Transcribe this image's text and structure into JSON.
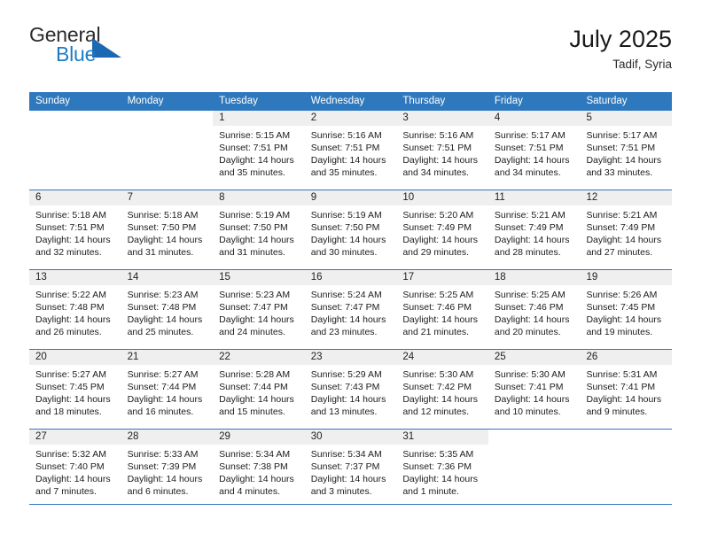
{
  "brand": {
    "name_top": "General",
    "name_bottom": "Blue",
    "triangle_color": "#1b68b3",
    "blue_color": "#1f7bc1"
  },
  "header": {
    "title": "July 2025",
    "subtitle": "Tadif, Syria"
  },
  "theme": {
    "header_blue": "#2e78bd",
    "date_strip_gray": "#efefef",
    "text": "#1c1c1c"
  },
  "weekdays": [
    "Sunday",
    "Monday",
    "Tuesday",
    "Wednesday",
    "Thursday",
    "Friday",
    "Saturday"
  ],
  "labels": {
    "sunrise_prefix": "Sunrise:",
    "sunset_prefix": "Sunset:",
    "daylight_prefix": "Daylight:"
  },
  "weeks": [
    [
      {
        "day": "",
        "line1": "",
        "line2": "",
        "line3": "",
        "line4": ""
      },
      {
        "day": "",
        "line1": "",
        "line2": "",
        "line3": "",
        "line4": ""
      },
      {
        "day": "1",
        "line1": "Sunrise: 5:15 AM",
        "line2": "Sunset: 7:51 PM",
        "line3": "Daylight: 14 hours",
        "line4": "and 35 minutes."
      },
      {
        "day": "2",
        "line1": "Sunrise: 5:16 AM",
        "line2": "Sunset: 7:51 PM",
        "line3": "Daylight: 14 hours",
        "line4": "and 35 minutes."
      },
      {
        "day": "3",
        "line1": "Sunrise: 5:16 AM",
        "line2": "Sunset: 7:51 PM",
        "line3": "Daylight: 14 hours",
        "line4": "and 34 minutes."
      },
      {
        "day": "4",
        "line1": "Sunrise: 5:17 AM",
        "line2": "Sunset: 7:51 PM",
        "line3": "Daylight: 14 hours",
        "line4": "and 34 minutes."
      },
      {
        "day": "5",
        "line1": "Sunrise: 5:17 AM",
        "line2": "Sunset: 7:51 PM",
        "line3": "Daylight: 14 hours",
        "line4": "and 33 minutes."
      }
    ],
    [
      {
        "day": "6",
        "line1": "Sunrise: 5:18 AM",
        "line2": "Sunset: 7:51 PM",
        "line3": "Daylight: 14 hours",
        "line4": "and 32 minutes."
      },
      {
        "day": "7",
        "line1": "Sunrise: 5:18 AM",
        "line2": "Sunset: 7:50 PM",
        "line3": "Daylight: 14 hours",
        "line4": "and 31 minutes."
      },
      {
        "day": "8",
        "line1": "Sunrise: 5:19 AM",
        "line2": "Sunset: 7:50 PM",
        "line3": "Daylight: 14 hours",
        "line4": "and 31 minutes."
      },
      {
        "day": "9",
        "line1": "Sunrise: 5:19 AM",
        "line2": "Sunset: 7:50 PM",
        "line3": "Daylight: 14 hours",
        "line4": "and 30 minutes."
      },
      {
        "day": "10",
        "line1": "Sunrise: 5:20 AM",
        "line2": "Sunset: 7:49 PM",
        "line3": "Daylight: 14 hours",
        "line4": "and 29 minutes."
      },
      {
        "day": "11",
        "line1": "Sunrise: 5:21 AM",
        "line2": "Sunset: 7:49 PM",
        "line3": "Daylight: 14 hours",
        "line4": "and 28 minutes."
      },
      {
        "day": "12",
        "line1": "Sunrise: 5:21 AM",
        "line2": "Sunset: 7:49 PM",
        "line3": "Daylight: 14 hours",
        "line4": "and 27 minutes."
      }
    ],
    [
      {
        "day": "13",
        "line1": "Sunrise: 5:22 AM",
        "line2": "Sunset: 7:48 PM",
        "line3": "Daylight: 14 hours",
        "line4": "and 26 minutes."
      },
      {
        "day": "14",
        "line1": "Sunrise: 5:23 AM",
        "line2": "Sunset: 7:48 PM",
        "line3": "Daylight: 14 hours",
        "line4": "and 25 minutes."
      },
      {
        "day": "15",
        "line1": "Sunrise: 5:23 AM",
        "line2": "Sunset: 7:47 PM",
        "line3": "Daylight: 14 hours",
        "line4": "and 24 minutes."
      },
      {
        "day": "16",
        "line1": "Sunrise: 5:24 AM",
        "line2": "Sunset: 7:47 PM",
        "line3": "Daylight: 14 hours",
        "line4": "and 23 minutes."
      },
      {
        "day": "17",
        "line1": "Sunrise: 5:25 AM",
        "line2": "Sunset: 7:46 PM",
        "line3": "Daylight: 14 hours",
        "line4": "and 21 minutes."
      },
      {
        "day": "18",
        "line1": "Sunrise: 5:25 AM",
        "line2": "Sunset: 7:46 PM",
        "line3": "Daylight: 14 hours",
        "line4": "and 20 minutes."
      },
      {
        "day": "19",
        "line1": "Sunrise: 5:26 AM",
        "line2": "Sunset: 7:45 PM",
        "line3": "Daylight: 14 hours",
        "line4": "and 19 minutes."
      }
    ],
    [
      {
        "day": "20",
        "line1": "Sunrise: 5:27 AM",
        "line2": "Sunset: 7:45 PM",
        "line3": "Daylight: 14 hours",
        "line4": "and 18 minutes."
      },
      {
        "day": "21",
        "line1": "Sunrise: 5:27 AM",
        "line2": "Sunset: 7:44 PM",
        "line3": "Daylight: 14 hours",
        "line4": "and 16 minutes."
      },
      {
        "day": "22",
        "line1": "Sunrise: 5:28 AM",
        "line2": "Sunset: 7:44 PM",
        "line3": "Daylight: 14 hours",
        "line4": "and 15 minutes."
      },
      {
        "day": "23",
        "line1": "Sunrise: 5:29 AM",
        "line2": "Sunset: 7:43 PM",
        "line3": "Daylight: 14 hours",
        "line4": "and 13 minutes."
      },
      {
        "day": "24",
        "line1": "Sunrise: 5:30 AM",
        "line2": "Sunset: 7:42 PM",
        "line3": "Daylight: 14 hours",
        "line4": "and 12 minutes."
      },
      {
        "day": "25",
        "line1": "Sunrise: 5:30 AM",
        "line2": "Sunset: 7:41 PM",
        "line3": "Daylight: 14 hours",
        "line4": "and 10 minutes."
      },
      {
        "day": "26",
        "line1": "Sunrise: 5:31 AM",
        "line2": "Sunset: 7:41 PM",
        "line3": "Daylight: 14 hours",
        "line4": "and 9 minutes."
      }
    ],
    [
      {
        "day": "27",
        "line1": "Sunrise: 5:32 AM",
        "line2": "Sunset: 7:40 PM",
        "line3": "Daylight: 14 hours",
        "line4": "and 7 minutes."
      },
      {
        "day": "28",
        "line1": "Sunrise: 5:33 AM",
        "line2": "Sunset: 7:39 PM",
        "line3": "Daylight: 14 hours",
        "line4": "and 6 minutes."
      },
      {
        "day": "29",
        "line1": "Sunrise: 5:34 AM",
        "line2": "Sunset: 7:38 PM",
        "line3": "Daylight: 14 hours",
        "line4": "and 4 minutes."
      },
      {
        "day": "30",
        "line1": "Sunrise: 5:34 AM",
        "line2": "Sunset: 7:37 PM",
        "line3": "Daylight: 14 hours",
        "line4": "and 3 minutes."
      },
      {
        "day": "31",
        "line1": "Sunrise: 5:35 AM",
        "line2": "Sunset: 7:36 PM",
        "line3": "Daylight: 14 hours",
        "line4": "and 1 minute."
      },
      {
        "day": "",
        "line1": "",
        "line2": "",
        "line3": "",
        "line4": ""
      },
      {
        "day": "",
        "line1": "",
        "line2": "",
        "line3": "",
        "line4": ""
      }
    ]
  ]
}
